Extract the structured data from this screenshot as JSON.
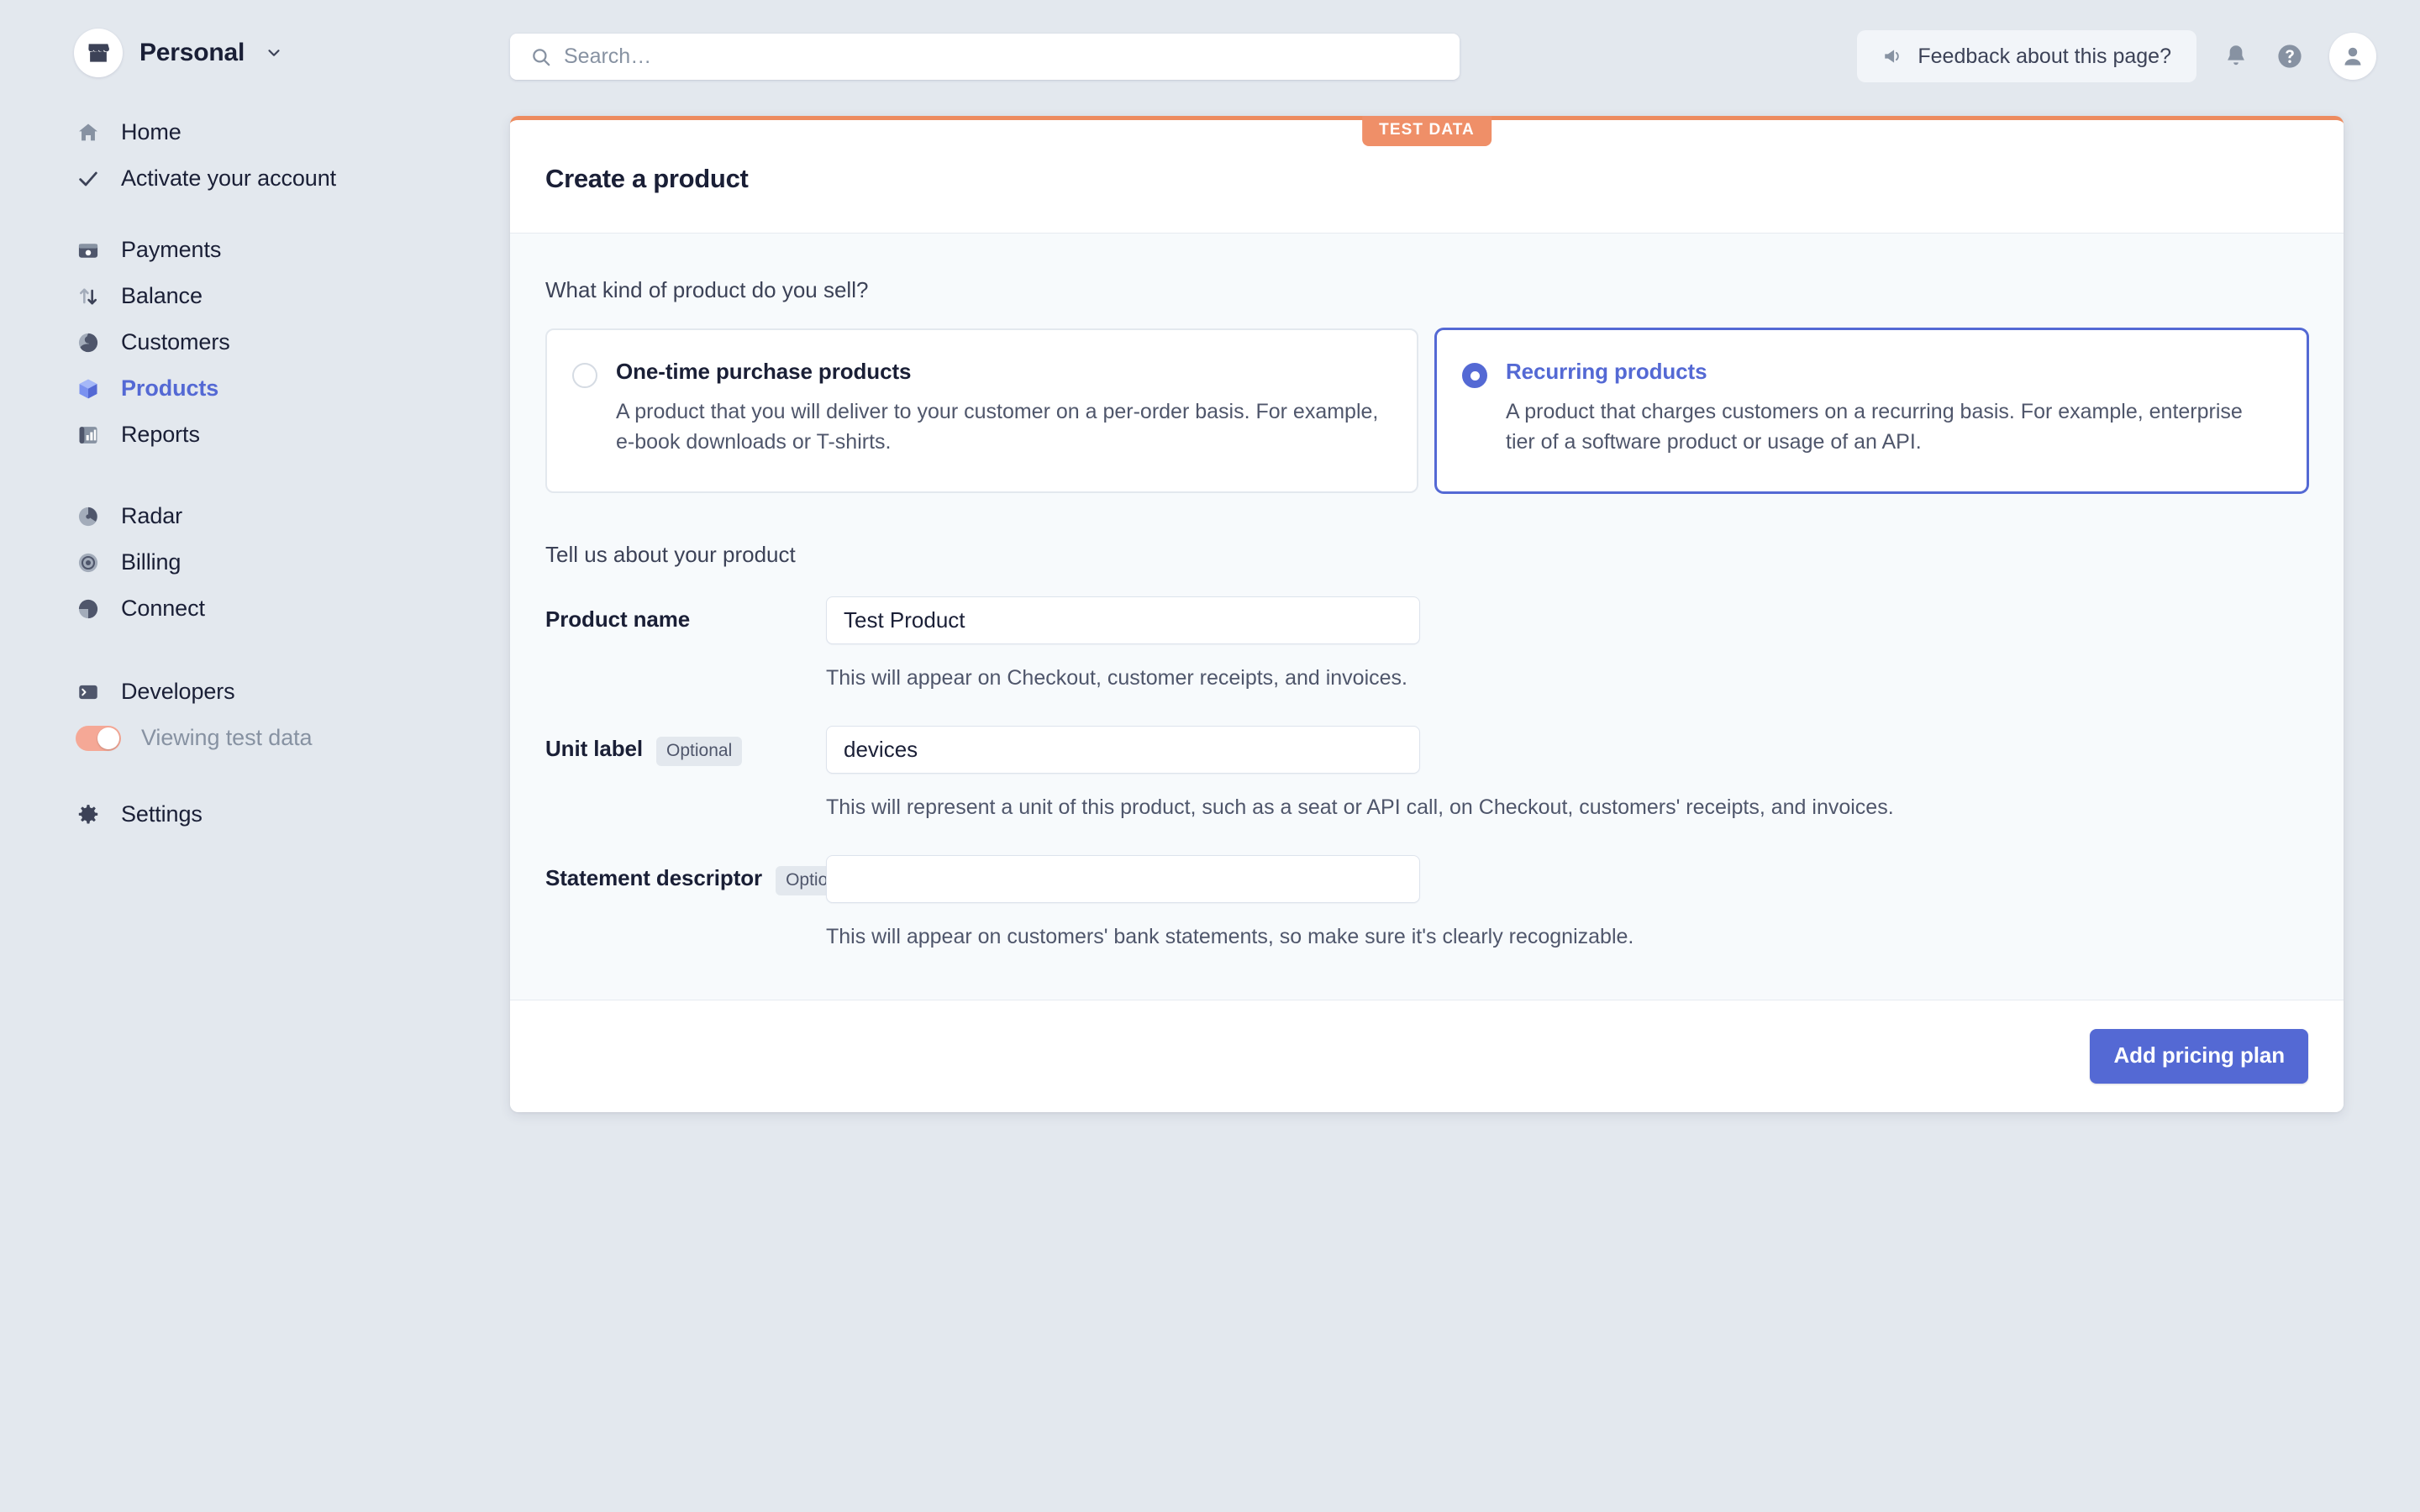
{
  "theme": {
    "accent": "#5469d4",
    "test_accent": "#ed8b5f",
    "page_bg": "#e3e8ee",
    "card_body_bg": "#f7fafc"
  },
  "sidebar": {
    "account": {
      "name": "Personal",
      "logo_icon": "storefront-icon",
      "caret_icon": "chevron-down-icon"
    },
    "groups": [
      {
        "items": [
          {
            "label": "Home",
            "icon": "home-icon",
            "state": "default"
          },
          {
            "label": "Activate your account",
            "icon": "check-icon",
            "state": "default"
          }
        ]
      },
      {
        "items": [
          {
            "label": "Payments",
            "icon": "payments-icon",
            "state": "default"
          },
          {
            "label": "Balance",
            "icon": "balance-icon",
            "state": "default"
          },
          {
            "label": "Customers",
            "icon": "customers-icon",
            "state": "default"
          },
          {
            "label": "Products",
            "icon": "products-icon",
            "state": "active"
          },
          {
            "label": "Reports",
            "icon": "reports-icon",
            "state": "default"
          }
        ]
      },
      {
        "items": [
          {
            "label": "Radar",
            "icon": "radar-icon",
            "state": "default"
          },
          {
            "label": "Billing",
            "icon": "billing-icon",
            "state": "default"
          },
          {
            "label": "Connect",
            "icon": "connect-icon",
            "state": "default"
          }
        ]
      },
      {
        "items": [
          {
            "label": "Developers",
            "icon": "terminal-icon",
            "state": "default"
          },
          {
            "label": "Viewing test data",
            "icon": "toggle-on-icon",
            "state": "muted"
          }
        ]
      },
      {
        "items": [
          {
            "label": "Settings",
            "icon": "gear-icon",
            "state": "default"
          }
        ]
      }
    ]
  },
  "topbar": {
    "search": {
      "placeholder": "Search…",
      "value": "",
      "icon": "search-icon"
    },
    "feedback": {
      "label": "Feedback about this page?",
      "icon": "megaphone-icon"
    },
    "notifications_icon": "bell-icon",
    "help_icon": "question-circle-icon",
    "account_icon": "user-avatar-icon"
  },
  "card": {
    "badge": "TEST DATA",
    "title": "Create a product",
    "product_kind": {
      "heading": "What kind of product do you sell?",
      "options": [
        {
          "title": "One-time purchase products",
          "description": "A product that you will deliver to your customer on a per-order basis. For example, e-book downloads or T-shirts.",
          "selected": false
        },
        {
          "title": "Recurring products",
          "description": "A product that charges customers on a recurring basis. For example, enterprise tier of a software product or usage of an API.",
          "selected": true
        }
      ]
    },
    "details": {
      "heading": "Tell us about your product",
      "fields": [
        {
          "label": "Product name",
          "optional_badge": "",
          "value": "Test Product",
          "placeholder": "",
          "help": "This will appear on Checkout, customer receipts, and invoices."
        },
        {
          "label": "Unit label",
          "optional_badge": "Optional",
          "value": "devices",
          "placeholder": "",
          "help": "This will represent a unit of this product, such as a seat or API call, on Checkout, customers' receipts, and invoices."
        },
        {
          "label": "Statement descriptor",
          "optional_badge": "Optional",
          "value": "",
          "placeholder": "",
          "help": "This will appear on customers' bank statements, so make sure it's clearly recognizable."
        }
      ]
    },
    "footer": {
      "primary_button": "Add pricing plan"
    }
  }
}
